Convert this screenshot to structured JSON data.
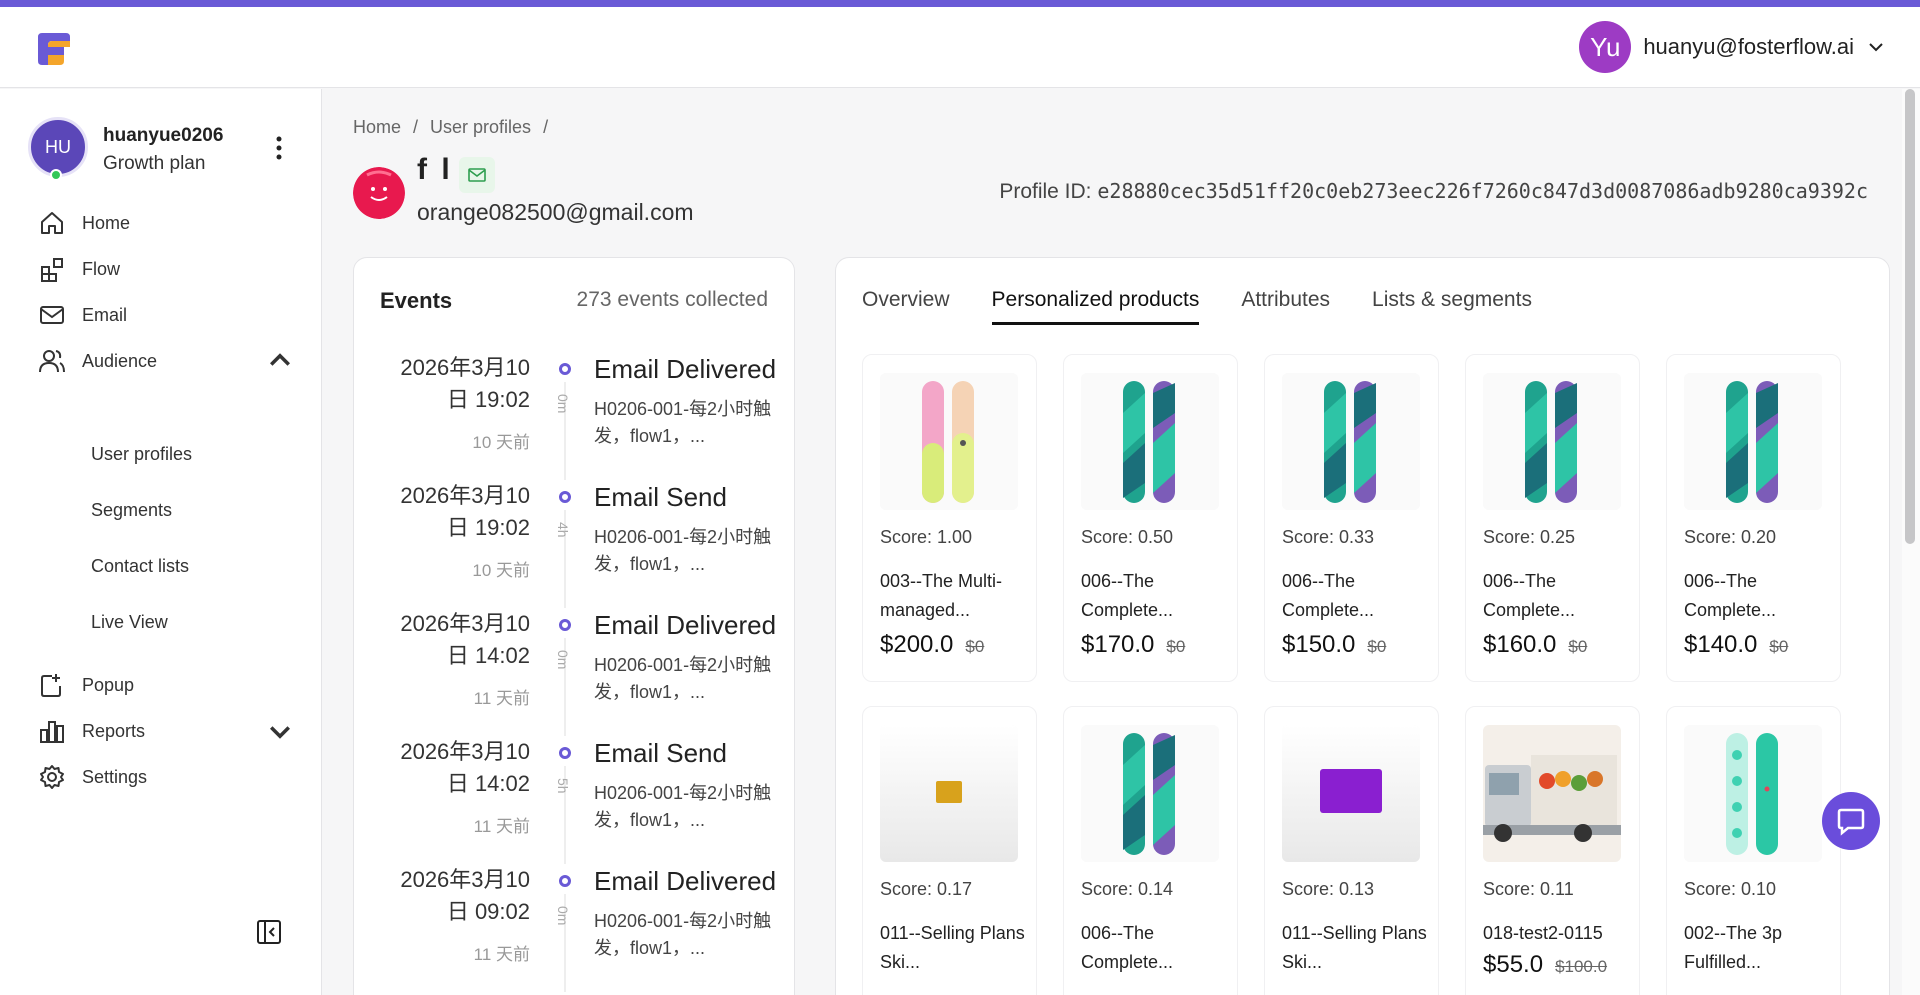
{
  "header": {
    "user_initials": "Yu",
    "user_email": "huanyu@fosterflow.ai"
  },
  "sidebar": {
    "account": {
      "initials": "HU",
      "name": "huanyue0206",
      "plan": "Growth plan"
    },
    "items": [
      {
        "label": "Home",
        "icon": "home-icon"
      },
      {
        "label": "Flow",
        "icon": "flow-icon"
      },
      {
        "label": "Email",
        "icon": "mail-icon"
      },
      {
        "label": "Audience",
        "icon": "users-icon",
        "expanded": true
      },
      {
        "label": "Popup",
        "icon": "popup-icon"
      },
      {
        "label": "Reports",
        "icon": "bar-chart-icon"
      },
      {
        "label": "Settings",
        "icon": "gear-icon"
      }
    ],
    "audience_sub": [
      "User profiles",
      "Segments",
      "Contact lists",
      "Live View"
    ]
  },
  "breadcrumb": [
    "Home",
    "/",
    "User profiles",
    "/"
  ],
  "profile": {
    "name": "f l",
    "email": "orange082500@gmail.com",
    "id_label": "Profile ID:",
    "id_value": "e28880cec35d51ff20c0eb273eec226f7260c847d3d0087086adb9280ca9392c"
  },
  "events": {
    "title": "Events",
    "count": "273 events collected",
    "items": [
      {
        "date": "2026年3月10",
        "time": "日 19:02",
        "ago": "10 天前",
        "duration": "0m",
        "type": "Email Delivered",
        "desc": "H0206-001-每2小时触发，flow1，..."
      },
      {
        "date": "2026年3月10",
        "time": "日 19:02",
        "ago": "10 天前",
        "duration": "4h",
        "type": "Email Send",
        "desc": "H0206-001-每2小时触发，flow1，..."
      },
      {
        "date": "2026年3月10",
        "time": "日 14:02",
        "ago": "11 天前",
        "duration": "0m",
        "type": "Email Delivered",
        "desc": "H0206-001-每2小时触发，flow1，..."
      },
      {
        "date": "2026年3月10",
        "time": "日 14:02",
        "ago": "11 天前",
        "duration": "5h",
        "type": "Email Send",
        "desc": "H0206-001-每2小时触发，flow1，..."
      },
      {
        "date": "2026年3月10",
        "time": "日 09:02",
        "ago": "11 天前",
        "duration": "0m",
        "type": "Email Delivered",
        "desc": "H0206-001-每2小时触发，flow1，..."
      }
    ]
  },
  "tabs": [
    "Overview",
    "Personalized products",
    "Attributes",
    "Lists & segments"
  ],
  "active_tab": "Personalized products",
  "products": [
    {
      "score": "Score: 1.00",
      "title": "003--The Multi-managed...",
      "price": "$200.0",
      "old": "$0",
      "image": "snowboard-pastel"
    },
    {
      "score": "Score: 0.50",
      "title": "006--The Complete...",
      "price": "$170.0",
      "old": "$0",
      "image": "snowboard-teal"
    },
    {
      "score": "Score: 0.33",
      "title": "006--The Complete...",
      "price": "$150.0",
      "old": "$0",
      "image": "snowboard-teal"
    },
    {
      "score": "Score: 0.25",
      "title": "006--The Complete...",
      "price": "$160.0",
      "old": "$0",
      "image": "snowboard-teal"
    },
    {
      "score": "Score: 0.20",
      "title": "006--The Complete...",
      "price": "$140.0",
      "old": "$0",
      "image": "snowboard-teal"
    },
    {
      "score": "Score: 0.17",
      "title": "011--Selling Plans Ski...",
      "price": "",
      "old": "",
      "image": "wax-yellow"
    },
    {
      "score": "Score: 0.14",
      "title": "006--The Complete...",
      "price": "",
      "old": "",
      "image": "snowboard-teal"
    },
    {
      "score": "Score: 0.13",
      "title": "011--Selling Plans Ski...",
      "price": "",
      "old": "",
      "image": "wax-purple"
    },
    {
      "score": "Score: 0.11",
      "title": "018-test2-0115",
      "price": "$55.0",
      "old": "$100.0",
      "image": "truck-photo"
    },
    {
      "score": "Score: 0.10",
      "title": "002--The 3p Fulfilled...",
      "price": "",
      "old": "",
      "image": "snowboard-mint"
    }
  ],
  "colors": {
    "accent": "#6a5ad6",
    "avatar_purple": "#9d3bc4",
    "profile_avatar": "#e8194e",
    "teal": "#1fa38e"
  }
}
